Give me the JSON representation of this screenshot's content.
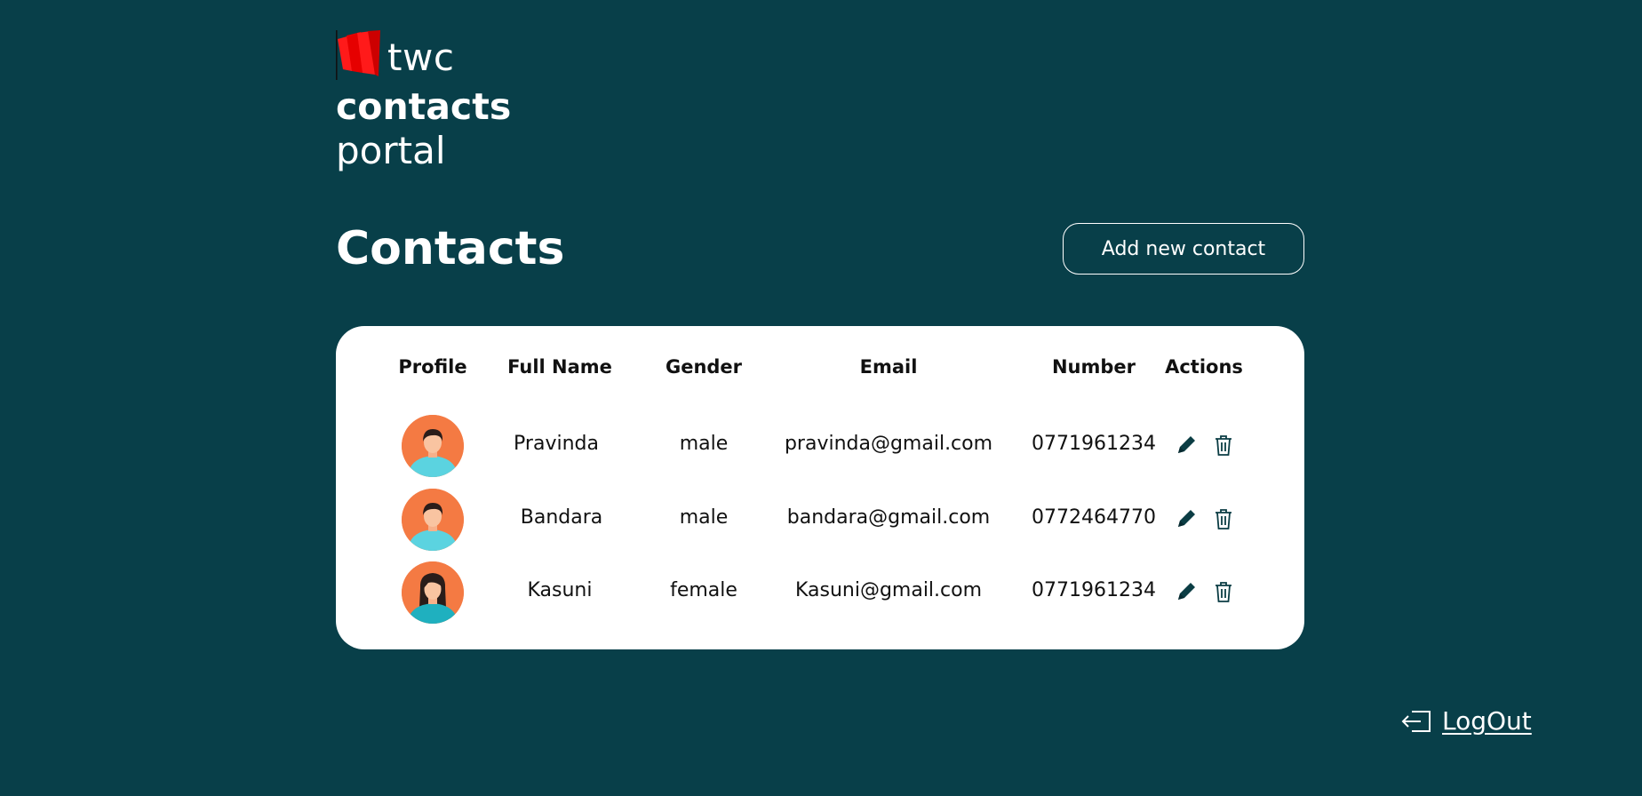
{
  "brand": {
    "name": "twc",
    "line1": "contacts",
    "line2": "portal",
    "logo_color": "#ff1a1a"
  },
  "page": {
    "title": "Contacts",
    "add_button_label": "Add new contact",
    "background": "#083f49"
  },
  "table": {
    "headers": {
      "profile": "Profile",
      "full_name": "Full Name",
      "gender": "Gender",
      "email": "Email",
      "number": "Number",
      "actions": "Actions"
    },
    "rows": [
      {
        "avatar": "male-avatar",
        "full_name": "Pravinda",
        "gender": "male",
        "email": "pravinda@gmail.com",
        "number": "0771961234"
      },
      {
        "avatar": "male-avatar",
        "full_name": "Bandara",
        "gender": "male",
        "email": "bandara@gmail.com",
        "number": "0772464770"
      },
      {
        "avatar": "female-avatar",
        "full_name": "Kasuni",
        "gender": "female",
        "email": "Kasuni@gmail.com",
        "number": "0771961234"
      }
    ],
    "action_icons": [
      "pencil-icon",
      "trash-icon"
    ]
  },
  "logout": {
    "label": "LogOut",
    "icon": "logout-icon"
  }
}
